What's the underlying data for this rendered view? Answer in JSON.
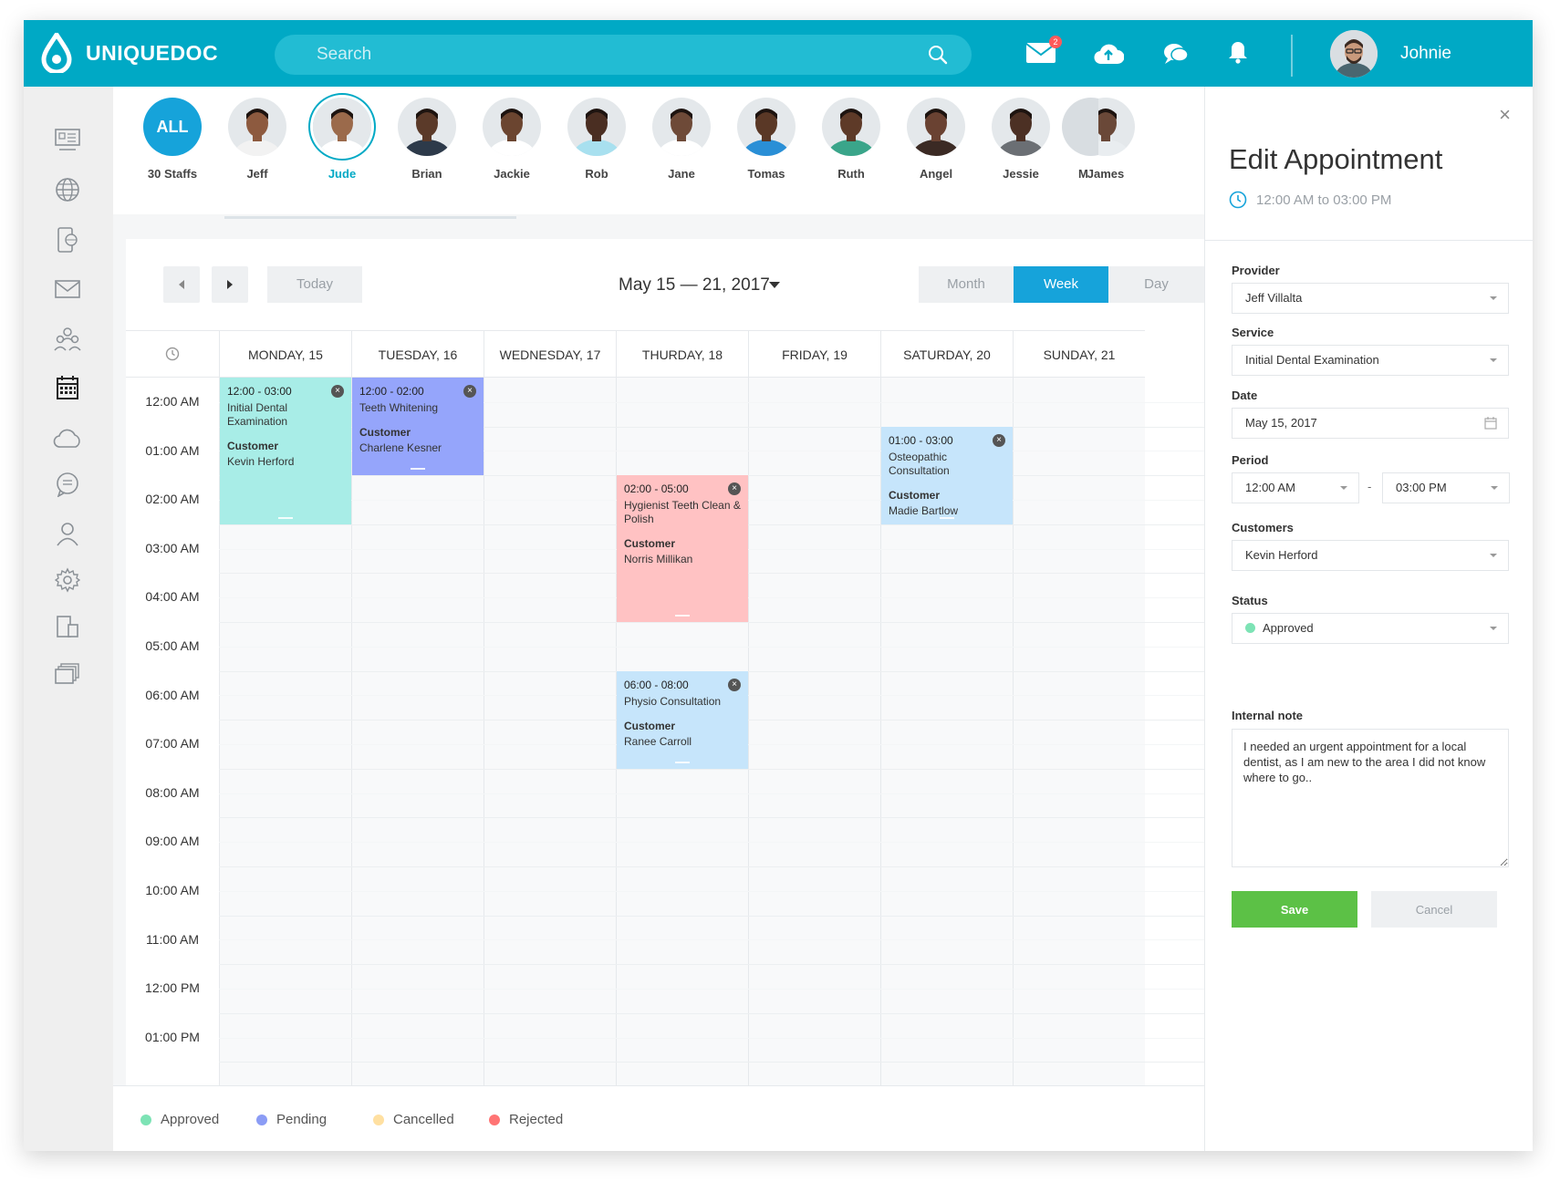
{
  "app": {
    "brand": "UNIQUEDOC"
  },
  "search": {
    "placeholder": "Search"
  },
  "header": {
    "user_name": "Johnie",
    "mail_badge": "2"
  },
  "staff": {
    "all_label": "ALL",
    "count_label": "30 Staffs",
    "members": [
      {
        "name": "Jeff",
        "skin": "#8d5a3f",
        "coat": "#f2f2f2"
      },
      {
        "name": "Jude",
        "skin": "#9b6a4b",
        "coat": "#ffffff"
      },
      {
        "name": "Brian",
        "skin": "#5b3a29",
        "coat": "#2d3a4a"
      },
      {
        "name": "Jackie",
        "skin": "#6b4530",
        "coat": "#ffffff"
      },
      {
        "name": "Rob",
        "skin": "#4a2e22",
        "coat": "#a8e0ef"
      },
      {
        "name": "Jane",
        "skin": "#6e4a38",
        "coat": "#ffffff"
      },
      {
        "name": "Tomas",
        "skin": "#5a3826",
        "coat": "#2a8fd6"
      },
      {
        "name": "Ruth",
        "skin": "#5e3a28",
        "coat": "#3aa58a"
      },
      {
        "name": "Angel",
        "skin": "#6a4232",
        "coat": "#3b2a24"
      },
      {
        "name": "Jessie",
        "skin": "#4c3024",
        "coat": "#6b6f74"
      },
      {
        "name": "James",
        "skin": "#6a4838",
        "coat": "#e9edf0"
      }
    ],
    "partial_last": "M"
  },
  "calendar": {
    "today_label": "Today",
    "range_title": "May 15 — 21, 2017",
    "views": [
      "Month",
      "Week",
      "Day"
    ],
    "active_view": "Week",
    "days": [
      "MONDAY, 15",
      "TUESDAY, 16",
      "WEDNESDAY, 17",
      "THURDAY, 18",
      "FRIDAY, 19",
      "SATURDAY, 20",
      "SUNDAY, 21"
    ],
    "times": [
      "12:00 AM",
      "01:00 AM",
      "02:00 AM",
      "03:00 AM",
      "04:00 AM",
      "05:00 AM",
      "06:00 AM",
      "07:00 AM",
      "08:00 AM",
      "09:00 AM",
      "10:00 AM",
      "11:00 AM",
      "12:00 PM",
      "01:00 PM"
    ],
    "events": [
      {
        "day": 0,
        "start": 0,
        "end": 3,
        "time": "12:00 - 03:00",
        "service": "Initial Dental Examination",
        "customer_label": "Customer",
        "customer": "Kevin Herford",
        "color": "#a8ede7"
      },
      {
        "day": 1,
        "start": 0,
        "end": 2,
        "time": "12:00 - 02:00",
        "service": "Teeth Whitening",
        "customer_label": "Customer",
        "customer": "Charlene Kesner",
        "color": "#95a5fb"
      },
      {
        "day": 3,
        "start": 2,
        "end": 5,
        "time": "02:00 - 05:00",
        "service": "Hygienist Teeth Clean & Polish",
        "customer_label": "Customer",
        "customer": "Norris Millikan",
        "color": "#ffc2c3"
      },
      {
        "day": 3,
        "start": 6,
        "end": 8,
        "time": "06:00 - 08:00",
        "service": "Physio Consultation",
        "customer_label": "Customer",
        "customer": "Ranee Carroll",
        "color": "#c6e5fb"
      },
      {
        "day": 5,
        "start": 1,
        "end": 3,
        "time": "01:00 - 03:00",
        "service": "Osteopathic Consultation",
        "customer_label": "Customer",
        "customer": "Madie Bartlow",
        "color": "#c6e5fb"
      }
    ]
  },
  "legend": [
    {
      "label": "Approved",
      "color": "#7de3b5"
    },
    {
      "label": "Pending",
      "color": "#8b9cf5"
    },
    {
      "label": "Cancelled",
      "color": "#ffe0a1"
    },
    {
      "label": "Rejected",
      "color": "#ff7474"
    }
  ],
  "edit_panel": {
    "title": "Edit Appointment",
    "time_range": "12:00 AM to 03:00 PM",
    "provider_label": "Provider",
    "provider_value": "Jeff Villalta",
    "service_label": "Service",
    "service_value": "Initial Dental Examination",
    "date_label": "Date",
    "date_value": "May 15, 2017",
    "period_label": "Period",
    "period_start": "12:00 AM",
    "period_sep": "-",
    "period_end": "03:00 PM",
    "customers_label": "Customers",
    "customers_value": "Kevin Herford",
    "status_label": "Status",
    "status_value": "Approved",
    "note_label": "Internal note",
    "note_value": "I needed an urgent appointment for a local dentist, as I am new to the area I did not know where to go..",
    "save_label": "Save",
    "cancel_label": "Cancel",
    "close_glyph": "×"
  }
}
